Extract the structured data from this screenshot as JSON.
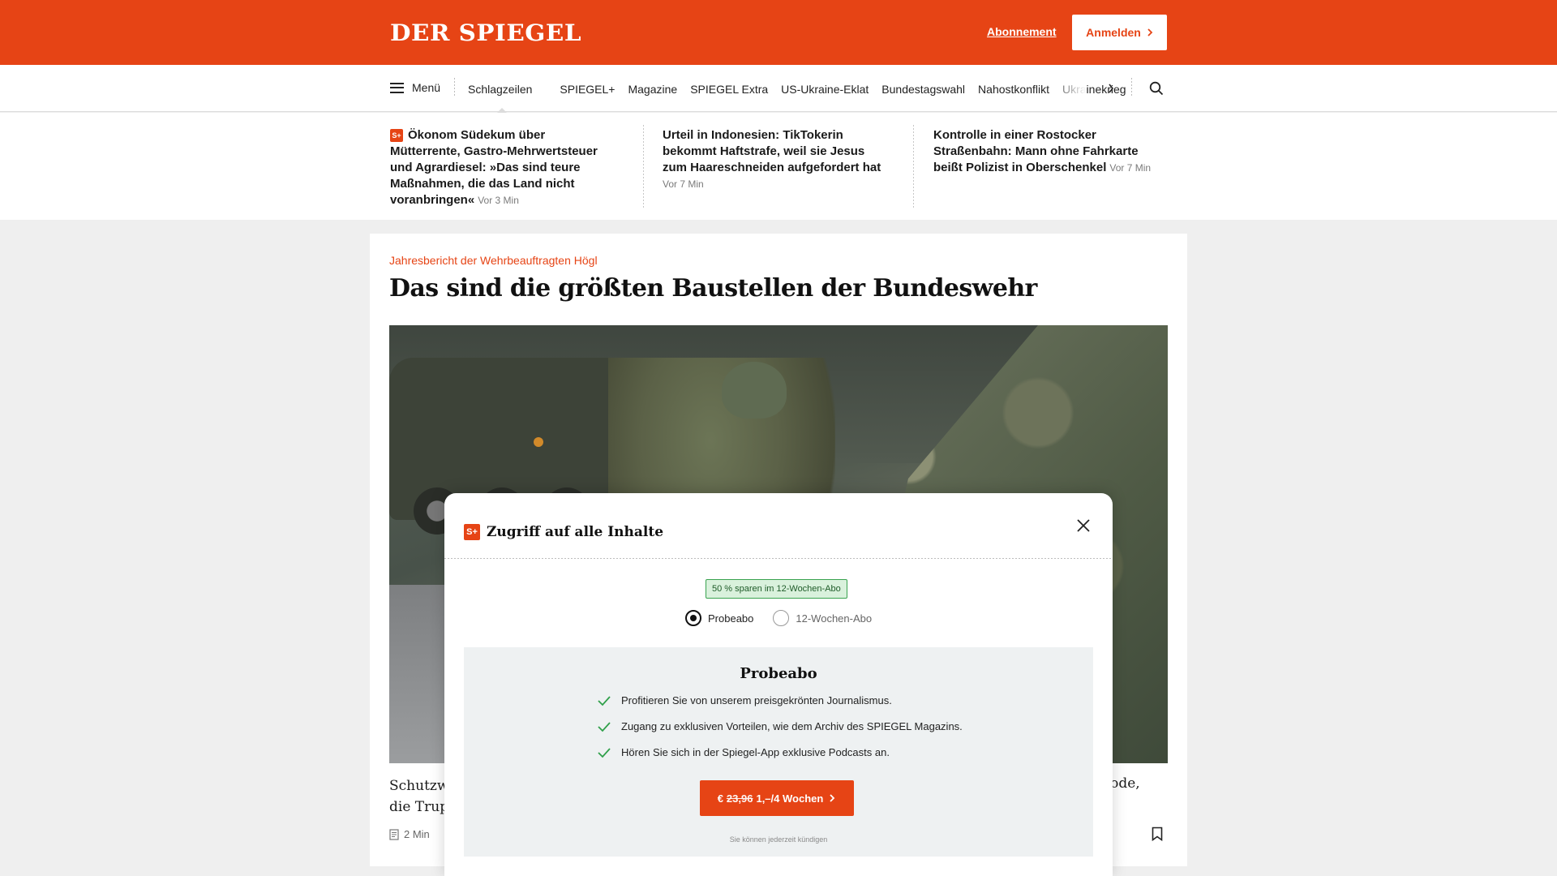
{
  "colors": {
    "brand": "#e64415",
    "check": "#2fa04a"
  },
  "header": {
    "logo": "DER SPIEGEL",
    "subscription_link": "Abonnement",
    "login_button": "Anmelden",
    "login_chevron_icon": "chevron-right-icon"
  },
  "nav": {
    "menu_label": "Menü",
    "items": [
      "Schlagzeilen",
      "SPIEGEL+",
      "Magazine",
      "SPIEGEL Extra",
      "US-Ukraine-Eklat",
      "Bundestagswahl",
      "Nahostkonflikt",
      "Ukrainekrieg"
    ],
    "active_item": "Schlagzeilen",
    "scroll_icon": "chevron-right-icon",
    "search_icon": "search-icon"
  },
  "ticker": [
    {
      "badge": "S+",
      "text": "Ökonom Südekum über Mütterrente, Gastro-Mehrwertsteuer und Agrardiesel: »Das sind teure Maßnahmen, die das Land nicht voranbringen«",
      "time": "Vor 3 Min"
    },
    {
      "badge": "",
      "text": "Urteil in Indonesien: TikTokerin bekommt Haftstrafe, weil sie Jesus zum Haareschneiden aufgefordert hat",
      "time": "Vor 7 Min"
    },
    {
      "badge": "",
      "text": "Kontrolle in einer Rostocker Straßenbahn: Mann ohne Fahrkarte beißt Polizist in Oberschenkel",
      "time": "Vor 7 Min"
    }
  ],
  "article": {
    "kicker": "Jahresbericht der Wehrbeauftragten Högl",
    "headline": "Das sind die größten Baustellen der Bundeswehr",
    "teaser_left_line1": "Schutzw",
    "teaser_left_line2": "die Trup",
    "teaser_right": "rode,",
    "read_time": "2 Min",
    "bookmark_icon": "bookmark-icon"
  },
  "modal": {
    "badge": "S+",
    "title": "Zugriff auf alle Inhalte",
    "close_icon": "close-icon",
    "savings_badge": "50 % sparen im 12-Wochen-Abo",
    "options": [
      {
        "label": "Probeabo",
        "selected": true
      },
      {
        "label": "12-Wochen-Abo",
        "selected": false
      }
    ],
    "plan": {
      "title": "Probeabo",
      "features": [
        "Profitieren Sie von unserem preisgekrönten Journalismus.",
        "Zugang zu exklusiven Vorteilen, wie dem Archiv des SPIEGEL Magazins.",
        "Hören Sie sich in der Spiegel-App exklusive Podcasts an."
      ],
      "cta_currency": "€",
      "cta_old_price": "23,96",
      "cta_new_price": "1,–/4 Wochen",
      "cancel_note": "Sie können jederzeit kündigen"
    }
  }
}
